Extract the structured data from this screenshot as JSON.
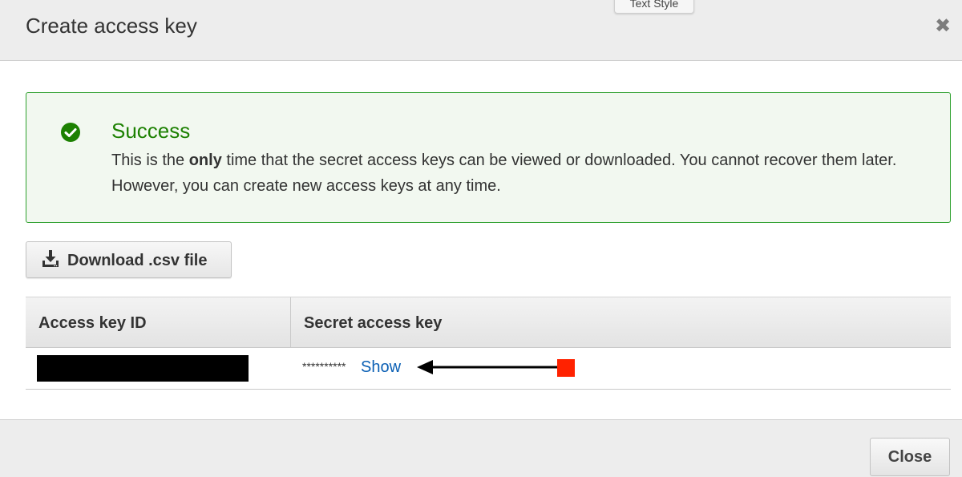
{
  "dialog": {
    "title": "Create access key",
    "close_glyph": "✖"
  },
  "tooltip": {
    "label": "Text Style"
  },
  "alert": {
    "icon": "check-circle-icon",
    "color": "#1d8102",
    "title": "Success",
    "message_pre": "This is the ",
    "message_bold": "only",
    "message_post": " time that the secret access keys can be viewed or downloaded. You cannot recover them later. However, you can create new access keys at any time."
  },
  "download": {
    "icon": "download-icon",
    "label": "Download .csv file"
  },
  "table": {
    "headers": [
      "Access key ID",
      "Secret access key"
    ],
    "row": {
      "access_key_id": "",
      "secret_masked": "**********",
      "show_link": "Show"
    }
  },
  "annotation": {
    "arrow": "arrow-left-icon",
    "marker_color": "#ff2200"
  },
  "footer": {
    "close_label": "Close"
  }
}
